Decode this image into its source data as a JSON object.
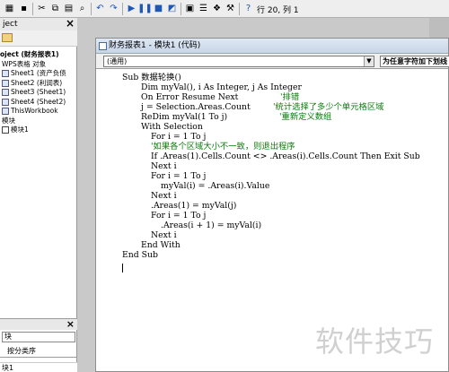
{
  "toolbar": {
    "cursor_position": "行 20, 列 1"
  },
  "project_explorer": {
    "title": "ject",
    "tree": [
      "oject (财务报表1)",
      "WPS表格 对象",
      "Sheet1 (资产负债",
      "Sheet2 (利润表)",
      "Sheet3 (Sheet1)",
      "Sheet4 (Sheet2)",
      "ThisWorkbook",
      "模块",
      "模块1"
    ]
  },
  "properties": {
    "title": "",
    "object_combo": "块",
    "tab_selected": "按分类序",
    "name_row": "块1"
  },
  "code_window": {
    "title": "财务报表1 - 模块1 (代码)",
    "object_combo": "(通用)",
    "procedure_combo": "为任意字符加下划线"
  },
  "code_lines": [
    {
      "code": "Sub 数据轮换()",
      "comment": ""
    },
    {
      "code": "Dim myVal(), i As Integer, j As Integer",
      "comment": ""
    },
    {
      "code": "On Error Resume Next",
      "comment": "'排错"
    },
    {
      "code": "j = Selection.Areas.Count",
      "comment": "'统计选择了多少个单元格区域"
    },
    {
      "code": "ReDim myVal(1 To j)",
      "comment": "'重新定义数组"
    },
    {
      "code": "With Selection",
      "comment": ""
    },
    {
      "code": "For i = 1 To j",
      "comment": ""
    },
    {
      "code": "",
      "comment": "'如果各个区域大小不一致，则退出程序"
    },
    {
      "code": "If .Areas(1).Cells.Count <> .Areas(i).Cells.Count Then Exit Sub",
      "comment": ""
    },
    {
      "code": "Next i",
      "comment": ""
    },
    {
      "code": "For i = 1 To j",
      "comment": ""
    },
    {
      "code": "myVal(i) = .Areas(i).Value",
      "comment": ""
    },
    {
      "code": "Next i",
      "comment": ""
    },
    {
      "code": ".Areas(1) = myVal(j)",
      "comment": ""
    },
    {
      "code": "For i = 1 To j",
      "comment": ""
    },
    {
      "code": ".Areas(i + 1) = myVal(i)",
      "comment": ""
    },
    {
      "code": "Next i",
      "comment": ""
    },
    {
      "code": "End With",
      "comment": ""
    },
    {
      "code": "End Sub",
      "comment": ""
    }
  ],
  "watermark": "软件技巧"
}
